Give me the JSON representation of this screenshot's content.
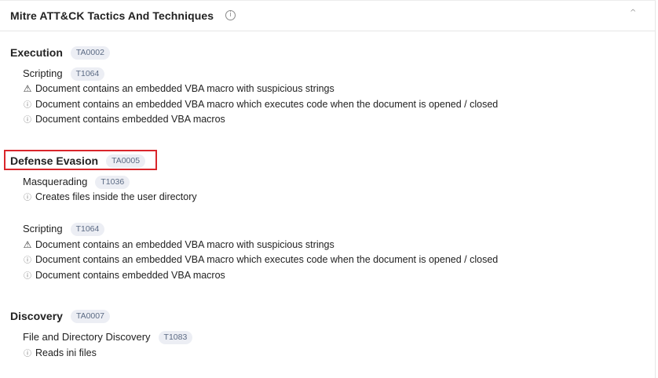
{
  "header": {
    "title": "Mitre ATT&CK Tactics And Techniques",
    "info_icon": "ⓘ",
    "collapse_icon": "^"
  },
  "colors": {
    "badge_bg": "#eceef4",
    "badge_text": "#5c6b84",
    "highlight_border": "#d9262b"
  },
  "tactics": [
    {
      "name": "Execution",
      "id": "TA0002",
      "techniques": [
        {
          "name": "Scripting",
          "id": "T1064",
          "findings": [
            {
              "severity": "warning-icon",
              "icon": "⚠",
              "text": "Document contains an embedded VBA macro with suspicious strings"
            },
            {
              "severity": "info-icon",
              "icon": "ⓘ",
              "text": "Document contains an embedded VBA macro which executes code when the document is opened / closed"
            },
            {
              "severity": "info-icon",
              "icon": "ⓘ",
              "text": "Document contains embedded VBA macros"
            }
          ]
        }
      ]
    },
    {
      "name": "Defense Evasion",
      "id": "TA0005",
      "techniques": [
        {
          "name": "Masquerading",
          "id": "T1036",
          "findings": [
            {
              "severity": "info-icon",
              "icon": "ⓘ",
              "text": "Creates files inside the user directory"
            }
          ]
        },
        {
          "name": "Scripting",
          "id": "T1064",
          "findings": [
            {
              "severity": "warning-icon",
              "icon": "⚠",
              "text": "Document contains an embedded VBA macro with suspicious strings"
            },
            {
              "severity": "info-icon",
              "icon": "ⓘ",
              "text": "Document contains an embedded VBA macro which executes code when the document is opened / closed"
            },
            {
              "severity": "info-icon",
              "icon": "ⓘ",
              "text": "Document contains embedded VBA macros"
            }
          ]
        }
      ]
    },
    {
      "name": "Discovery",
      "id": "TA0007",
      "techniques": [
        {
          "name": "File and Directory Discovery",
          "id": "T1083",
          "findings": [
            {
              "severity": "info-icon",
              "icon": "ⓘ",
              "text": "Reads ini files"
            }
          ]
        }
      ]
    }
  ]
}
